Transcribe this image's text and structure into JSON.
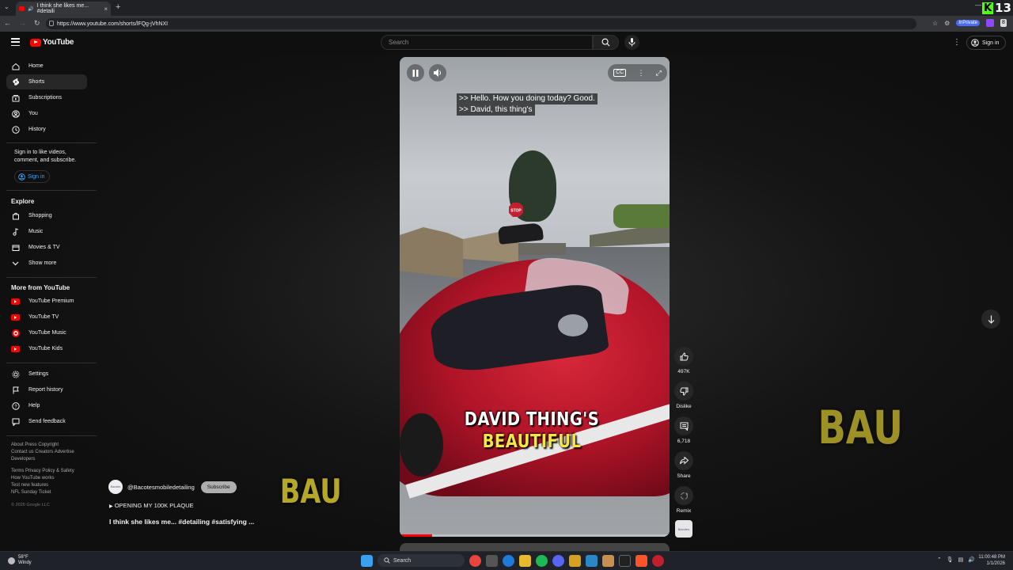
{
  "browser": {
    "tab_title": "I think she likes me... #detaili",
    "url": "https://www.youtube.com/shorts/lFQg-jVhNXI",
    "inprivate_label": "InPrivate",
    "overlay_badge": "13"
  },
  "header": {
    "logo_text": "YouTube",
    "search_placeholder": "Search",
    "signin_label": "Sign in"
  },
  "sidebar": {
    "main_items": [
      {
        "label": "Home",
        "icon": "home-icon"
      },
      {
        "label": "Shorts",
        "icon": "shorts-icon"
      },
      {
        "label": "Subscriptions",
        "icon": "subscriptions-icon"
      },
      {
        "label": "You",
        "icon": "you-icon"
      },
      {
        "label": "History",
        "icon": "history-icon"
      }
    ],
    "signin_prompt": "Sign in to like videos, comment, and subscribe.",
    "signin_button": "Sign in",
    "explore_heading": "Explore",
    "explore_items": [
      {
        "label": "Shopping"
      },
      {
        "label": "Music"
      },
      {
        "label": "Movies & TV"
      },
      {
        "label": "Show more"
      }
    ],
    "more_heading": "More from YouTube",
    "more_items": [
      {
        "label": "YouTube Premium"
      },
      {
        "label": "YouTube TV"
      },
      {
        "label": "YouTube Music"
      },
      {
        "label": "YouTube Kids"
      }
    ],
    "settings_items": [
      {
        "label": "Settings"
      },
      {
        "label": "Report history"
      },
      {
        "label": "Help"
      },
      {
        "label": "Send feedback"
      }
    ],
    "footer_1": "About  Press  Copyright\nContact us  Creators  Advertise\nDevelopers",
    "footer_2": "Terms  Privacy  Policy & Safety\nHow YouTube works\nTest new features\nNFL Sunday Ticket",
    "copyright": "© 2026 Google LLC"
  },
  "player": {
    "caption_line1": ">> Hello. How you doing today? Good.",
    "caption_line2": ">> David, this thing's",
    "overlay_line1": "DAVID THING'S",
    "overlay_line2": "BEAUTIFUL",
    "progress_fraction": 0.12,
    "stop_sign": "STOP"
  },
  "actions": {
    "likes": "497K",
    "dislike": "Dislike",
    "comments": "6,718",
    "share": "Share",
    "remix": "Remix"
  },
  "meta": {
    "channel": "@Bacotesmobiledetailing",
    "subscribe": "Subscribe",
    "plaque": "OPENING MY 100K PLAQUE",
    "title": "I think she likes me... #detailing #satisfying ...",
    "bau": "BAU",
    "channel_thumb_text": "Bacotes"
  },
  "taskbar": {
    "temp": "58°F",
    "weather": "Windy",
    "search": "Search",
    "time": "11:00:48 PM",
    "date": "1/1/2026"
  }
}
